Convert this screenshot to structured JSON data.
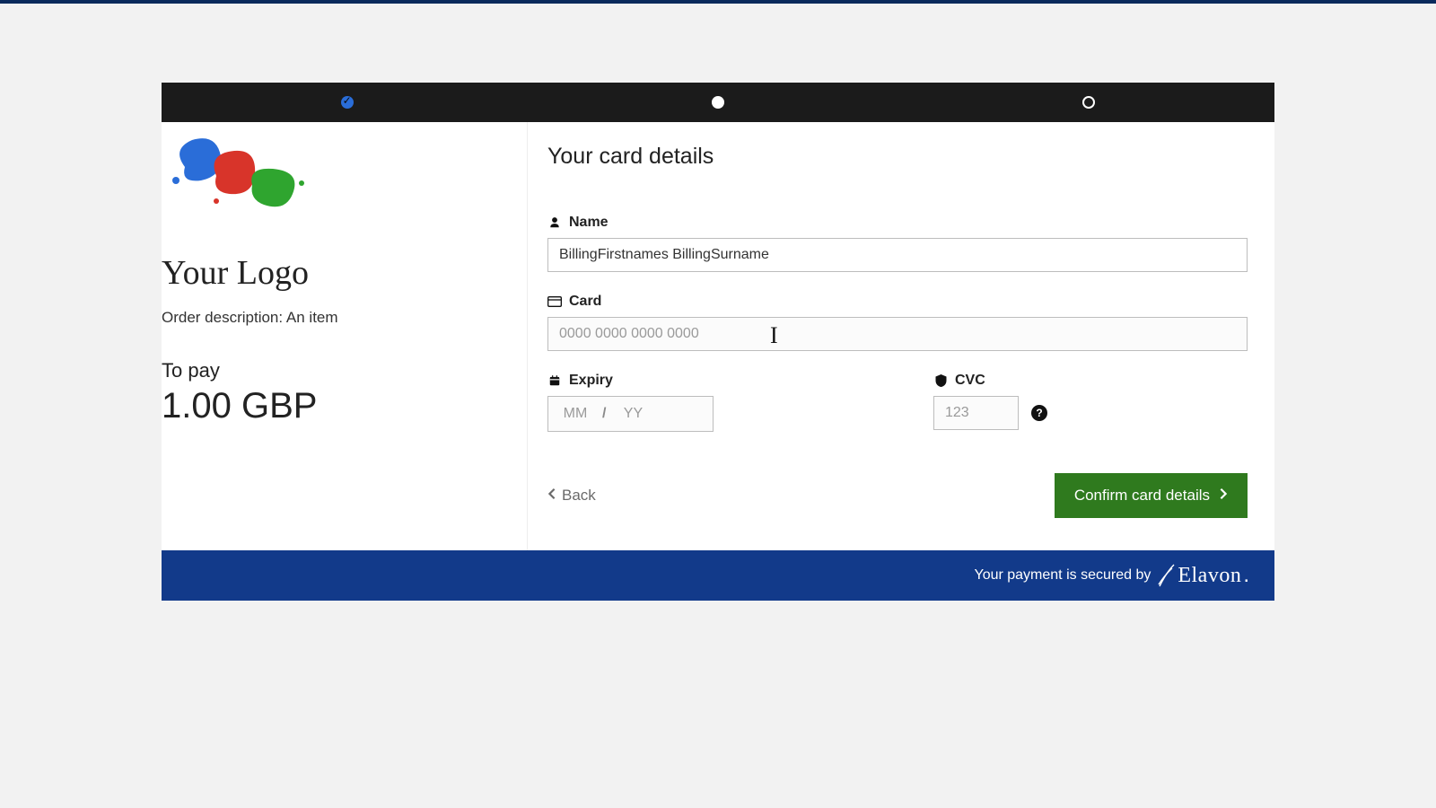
{
  "progress": {
    "steps": [
      "done",
      "current",
      "upcoming"
    ]
  },
  "left": {
    "logo_text": "Your Logo",
    "order_description": "Order description: An item",
    "to_pay_label": "To pay",
    "amount": "1.00 GBP"
  },
  "form": {
    "title": "Your card details",
    "name_label": "Name",
    "name_value": "BillingFirstnames BillingSurname",
    "card_label": "Card",
    "card_placeholder": "0000 0000 0000 0000",
    "card_value": "",
    "expiry_label": "Expiry",
    "expiry_mm_placeholder": "MM",
    "expiry_yy_placeholder": "YY",
    "expiry_separator": "/",
    "cvc_label": "CVC",
    "cvc_placeholder": "123",
    "back_label": "Back",
    "confirm_label": "Confirm card details"
  },
  "footer": {
    "secured_by": "Your payment is secured by",
    "brand": "Elavon"
  }
}
